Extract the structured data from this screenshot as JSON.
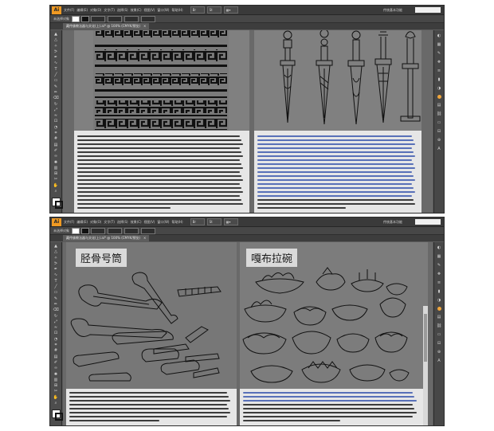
{
  "app": {
    "logo": "Ai"
  },
  "menus": [
    "文件(F)",
    "编辑(E)",
    "对象(O)",
    "文字(T)",
    "选择(S)",
    "效果(C)",
    "视图(V)",
    "窗口(W)",
    "帮助(H)"
  ],
  "workspace": "传统基本功能",
  "control_bar": {
    "label": "未选择对象",
    "tab_title_top": "藏传佛教法器与文化(上).ai* @ 100% (CMYK/预览)",
    "tab_title_bottom": "藏传佛教法器与文化(上).ai* @ 100% (CMYK/预览)"
  },
  "bottom_window": {
    "left_label": "胫骨号筒",
    "right_label": "嘎布拉碗"
  },
  "colors": {
    "app_bg": "#5b5b5b",
    "accent": "#f09a23",
    "page_gray": "#808080",
    "page_light": "#e6e6e6",
    "highlight_line": "#5870b8"
  },
  "tools": [
    "selection-tool",
    "direct-selection-tool",
    "magic-wand-tool",
    "lasso-tool",
    "pen-tool",
    "curvature-tool",
    "type-tool",
    "line-tool",
    "rectangle-tool",
    "paintbrush-tool",
    "pencil-tool",
    "eraser-tool",
    "rotate-tool",
    "scale-tool",
    "width-tool",
    "free-transform-tool",
    "shape-builder-tool",
    "perspective-tool",
    "mesh-tool",
    "gradient-tool",
    "eyedropper-tool",
    "blend-tool",
    "symbol-sprayer-tool",
    "column-graph-tool",
    "artboard-tool",
    "slice-tool",
    "hand-tool",
    "zoom-tool"
  ],
  "panel_icons": [
    "color-panel-icon",
    "swatches-panel-icon",
    "brushes-panel-icon",
    "symbols-panel-icon",
    "stroke-panel-icon",
    "gradient-panel-icon",
    "transparency-panel-icon",
    "appearance-panel-icon",
    "layers-panel-icon",
    "links-panel-icon",
    "artboards-panel-icon",
    "align-panel-icon",
    "pathfinder-panel-icon",
    "character-panel-icon"
  ]
}
